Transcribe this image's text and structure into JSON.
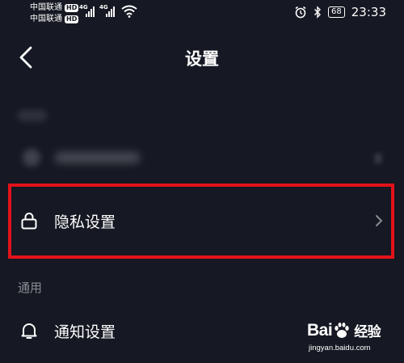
{
  "status_bar": {
    "carrier_1": "中国联通",
    "carrier_2": "中国联通",
    "hd_badge": "HD",
    "network_1": "4G",
    "network_2": "4G",
    "battery": "68",
    "time": "23:33",
    "icons": [
      "alarm-icon",
      "bluetooth-icon",
      "wifi-icon",
      "signal-icon"
    ]
  },
  "header": {
    "title": "设置",
    "back_icon": "chevron-left-icon"
  },
  "settings": {
    "privacy": {
      "label": "隐私设置",
      "icon": "lock-icon"
    },
    "general_section": "通用",
    "notification": {
      "label": "通知设置",
      "icon": "bell-icon"
    }
  },
  "watermark": {
    "logo_left": "Bai",
    "logo_right": "经验",
    "url": "jingyan.baidu.com"
  },
  "colors": {
    "background": "#161823",
    "highlight": "#e3121a",
    "section_label": "#8a8b92"
  }
}
